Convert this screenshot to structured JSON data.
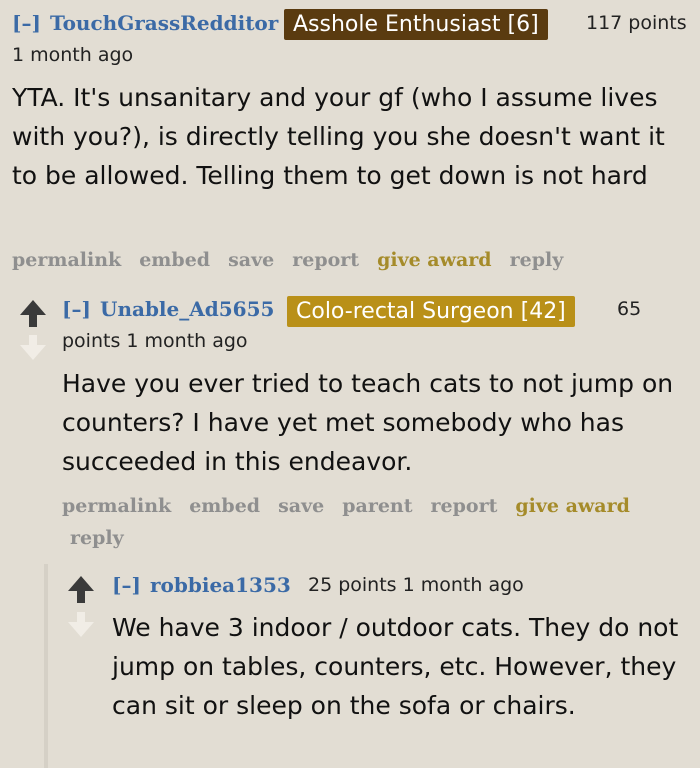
{
  "comments": [
    {
      "toggle": "[–]",
      "author": "TouchGrassRedditor",
      "flair": "Asshole Enthusiast [6]",
      "flair_color": "#5a3b10",
      "points": "117 points",
      "time": "1 month ago",
      "body": "YTA. It's unsanitary and your gf (who I assume lives with you?), is directly telling you she doesn't want it to be allowed. Telling them to get down is not hard",
      "actions": [
        "permalink",
        "embed",
        "save",
        "report",
        "give award",
        "reply"
      ]
    },
    {
      "toggle": "[–]",
      "author": "Unable_Ad5655",
      "flair": "Colo-rectal Surgeon [42]",
      "flair_color": "#b99018",
      "points_a": "65",
      "points_b": "points 1 month ago",
      "body": "Have you ever tried to teach cats to not jump on counters? I have yet met somebody who has succeeded in this endeavor.",
      "actions": [
        "permalink",
        "embed",
        "save",
        "parent",
        "report",
        "give award"
      ],
      "actions_line2": "reply"
    },
    {
      "toggle": "[–]",
      "author": "robbiea1353",
      "points": "25 points 1 month ago",
      "body": "We have 3 indoor / outdoor cats. They do not jump on tables, counters, etc. However, they can sit or sleep on the sofa or chairs."
    }
  ]
}
